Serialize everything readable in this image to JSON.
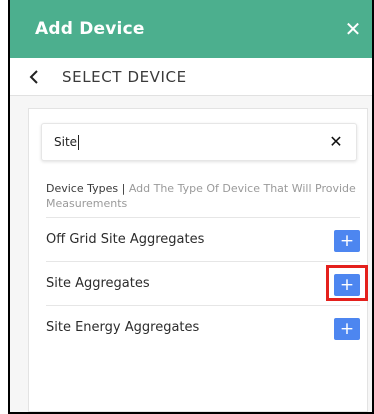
{
  "header": {
    "title": "Add Device",
    "close_icon": "close-icon"
  },
  "subheader": {
    "back_icon": "chevron-left-icon",
    "title": "SELECT DEVICE"
  },
  "search": {
    "value": "Site",
    "clear_icon": "close-icon"
  },
  "device_types": {
    "label": "Device Types |",
    "hint": " Add The Type Of Device That Will Provide Measurements"
  },
  "devices": [
    {
      "label": "Off Grid Site Aggregates",
      "add_label": "+"
    },
    {
      "label": "Site Aggregates",
      "add_label": "+",
      "highlighted": true
    },
    {
      "label": "Site Energy Aggregates",
      "add_label": "+"
    }
  ],
  "colors": {
    "header": "#4caf8e",
    "add_button": "#4d86f0",
    "highlight": "#e4201c"
  }
}
